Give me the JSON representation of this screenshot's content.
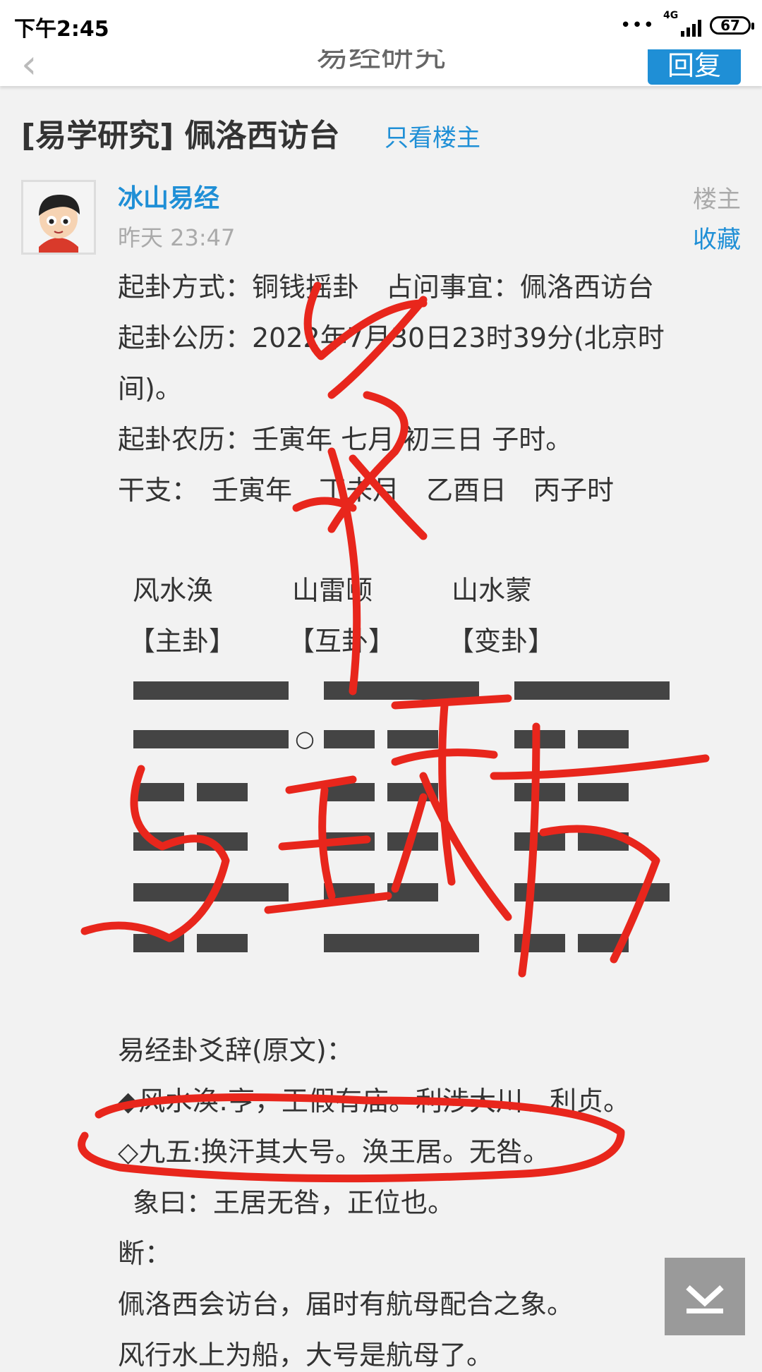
{
  "status": {
    "time": "下午2:45",
    "dots": "•••",
    "network": "4G",
    "battery": "67"
  },
  "nav": {
    "back_icon": "chevron-left-icon",
    "title": "易经研究",
    "reply_label": "回复"
  },
  "thread": {
    "title": "[易学研究] 佩洛西访台",
    "only_op": "只看楼主"
  },
  "post": {
    "author": "冰山易经",
    "time": "昨天 23:47",
    "badge": "楼主",
    "favorite": "收藏",
    "lines": [
      "起卦方式：铜钱摇卦　占问事宜：佩洛西访台",
      "起卦公历：2022年7月30日23时39分(北京时",
      "间)。",
      "起卦农历：壬寅年 七月 初三日 子时。",
      "干支：　壬寅年　丁未月　乙酉日　丙子时"
    ],
    "hexagrams": [
      {
        "name": "风水涣",
        "tag": "【主卦】",
        "lines_top_to_bottom": [
          "yang",
          "yang",
          "yin",
          "yin",
          "yang",
          "yin"
        ]
      },
      {
        "name": "山雷颐",
        "tag": "【互卦】",
        "lines_top_to_bottom": [
          "yang",
          "yin",
          "yin",
          "yin",
          "yin",
          "yang"
        ]
      },
      {
        "name": "山水蒙",
        "tag": "【变卦】",
        "lines_top_to_bottom": [
          "yang",
          "yin",
          "yin",
          "yin",
          "yang",
          "yin"
        ]
      }
    ],
    "moving_line_marker": "○",
    "text_lines": [
      "易经卦爻辞(原文)：",
      "◆风水涣:亨，王假有庙。利涉大川、利贞。",
      "◇九五:换汗其大号。涣王居。无咎。",
      "象曰：王居无咎，正位也。",
      "断：",
      "佩洛西会访台，届时有航母配合之象。",
      "风行水上为船，大号是航母了。"
    ]
  },
  "annotation": {
    "color": "#e8261c"
  },
  "scroll_icon": "arrow-down-to-bottom-icon"
}
